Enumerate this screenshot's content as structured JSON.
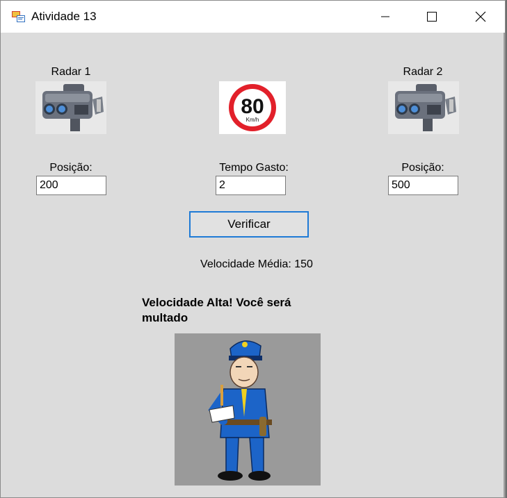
{
  "window": {
    "title": "Atividade 13",
    "app_icon": "form-app-icon"
  },
  "radar1": {
    "label": "Radar 1",
    "icon": "speed-camera-icon"
  },
  "radar2": {
    "label": "Radar 2",
    "icon": "speed-camera-icon"
  },
  "speed_limit": {
    "value": "80",
    "unit": "Km/h",
    "icon": "speed-limit-sign-icon"
  },
  "fields": {
    "posicao1": {
      "label": "Posição:",
      "value": "200"
    },
    "tempo": {
      "label": "Tempo Gasto:",
      "value": "2"
    },
    "posicao2": {
      "label": "Posição:",
      "value": "500"
    }
  },
  "verify_button": {
    "label": "Verificar"
  },
  "result": {
    "average_speed": "Velocidade Média: 150",
    "message": "Velocidade Alta! Você será multado",
    "image_icon": "police-officer-icon"
  },
  "colors": {
    "form_background": "#dcdcdc",
    "titlebar": "#ffffff",
    "button_focus_border": "#1e7ad6",
    "sign_red": "#e2202a",
    "police_blue": "#1c64c8"
  }
}
